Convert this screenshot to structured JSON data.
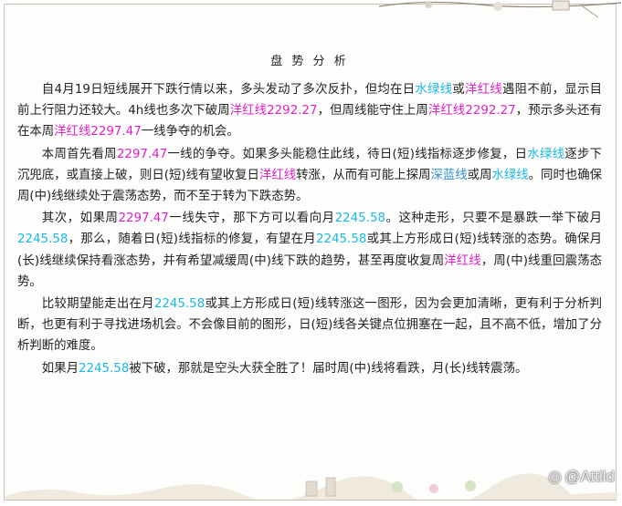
{
  "title": "盘 势 分 析",
  "paragraphs": [
    [
      {
        "t": "自4月19日短线展开下跌行情以来，多头发动了多次反扑，但均在日"
      },
      {
        "t": "水绿线",
        "c": "cyan"
      },
      {
        "t": "或"
      },
      {
        "t": "洋红线",
        "c": "magenta"
      },
      {
        "t": "遇阻不前，显示目前上行阻力还较大。4h线也多次下破周"
      },
      {
        "t": "洋红线2292.27",
        "c": "magenta"
      },
      {
        "t": "，但周线能守住上周"
      },
      {
        "t": "洋红线2292.27",
        "c": "magenta"
      },
      {
        "t": "，预示多头还有在本周"
      },
      {
        "t": "洋红线2297.47",
        "c": "magenta"
      },
      {
        "t": "一线争夺的机会。"
      }
    ],
    [
      {
        "t": "本周首先看周"
      },
      {
        "t": "2297.47",
        "c": "magenta"
      },
      {
        "t": "一线的争夺。如果多头能稳住此线，待日(短)线指标逐步修复，日"
      },
      {
        "t": "水绿线",
        "c": "cyan"
      },
      {
        "t": "逐步下沉兜底，或直接上破，则日(短)线有望收复日"
      },
      {
        "t": "洋红线",
        "c": "magenta"
      },
      {
        "t": "转涨，从而有可能上探周"
      },
      {
        "t": "深蓝线",
        "c": "blue"
      },
      {
        "t": "或周"
      },
      {
        "t": "水绿线",
        "c": "cyan"
      },
      {
        "t": "。同时也确保周(中)线继续处于震荡态势，而不至于转为下跌态势。"
      }
    ],
    [
      {
        "t": "其次，如果周"
      },
      {
        "t": "2297.47",
        "c": "magenta"
      },
      {
        "t": "一线失守，那下方可以看向月"
      },
      {
        "t": "2245.58",
        "c": "cyan"
      },
      {
        "t": "。这种走形，只要不是暴跌一举下破月"
      },
      {
        "t": "2245.58",
        "c": "cyan"
      },
      {
        "t": "，那么，随着日(短)线指标的修复，有望在月"
      },
      {
        "t": "2245.58",
        "c": "cyan"
      },
      {
        "t": "或其上方形成日(短)线转涨的态势。确保月(长)线继续保持看涨态势，并有希望减缓周(中)线下跌的趋势，甚至再度收复周"
      },
      {
        "t": "洋红线",
        "c": "magenta"
      },
      {
        "t": "，周(中)线重回震荡态势。"
      }
    ],
    [
      {
        "t": "比较期望能走出在月"
      },
      {
        "t": "2245.58",
        "c": "cyan"
      },
      {
        "t": "或其上方形成日(短)线转涨这一图形，因为会更加清晰，更有利于分析判断，也更有利于寻找进场机会。不会像目前的图形，日(短)线各关键点位拥塞在一起，且不高不低，增加了分析判断的难度。"
      }
    ],
    [
      {
        "t": "如果月"
      },
      {
        "t": "2245.58",
        "c": "cyan"
      },
      {
        "t": "被下破，那就是空头大获全胜了！届时周(中)线将看跌，月(长)线转震荡。"
      }
    ]
  ],
  "watermark": {
    "icon": "weibo-icon",
    "text": "@Attild"
  },
  "colors": {
    "cyan": "#19b8e6",
    "magenta": "#e020c8",
    "blue": "#2f8fd8"
  }
}
